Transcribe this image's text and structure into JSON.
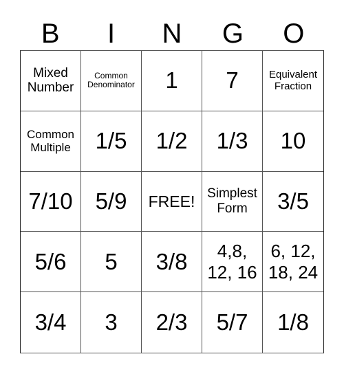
{
  "header": {
    "letters": [
      "B",
      "I",
      "N",
      "G",
      "O"
    ]
  },
  "card": {
    "rows": [
      [
        "Mixed\nNumber",
        "Common\nDenominator",
        "1",
        "7",
        "Equivalent\nFraction"
      ],
      [
        "Common\nMultiple",
        "1/5",
        "1/2",
        "1/3",
        "10"
      ],
      [
        "7/10",
        "5/9",
        "FREE!",
        "Simplest\nForm",
        "3/5"
      ],
      [
        "5/6",
        "5",
        "3/8",
        "4,8,\n12, 16",
        "6, 12,\n18, 24"
      ],
      [
        "3/4",
        "3",
        "2/3",
        "5/7",
        "1/8"
      ]
    ]
  }
}
